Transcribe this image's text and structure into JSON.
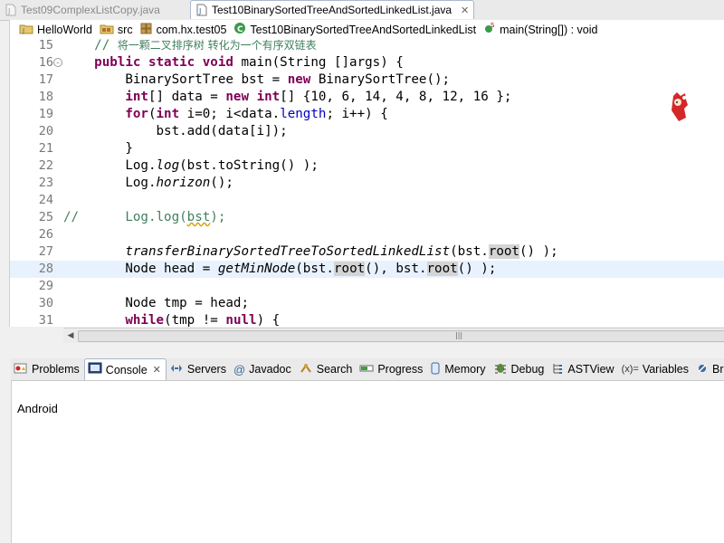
{
  "editor_tabs": [
    {
      "label": "Test09ComplexListCopy.java",
      "active": false
    },
    {
      "label": "Test10BinarySortedTreeAndSortedLinkedList.java",
      "active": true,
      "close": "✕"
    }
  ],
  "breadcrumb": [
    {
      "label": "HelloWorld",
      "icon": "project-icon"
    },
    {
      "label": "src",
      "icon": "source-folder-icon"
    },
    {
      "label": "com.hx.test05",
      "icon": "package-icon"
    },
    {
      "label": "Test10BinarySortedTreeAndSortedLinkedList",
      "icon": "class-icon"
    },
    {
      "label": "main(String[]) : void",
      "icon": "method-icon"
    }
  ],
  "code": {
    "current_line": "28",
    "lines": [
      {
        "n": "15"
      },
      {
        "n": "16"
      },
      {
        "n": "17"
      },
      {
        "n": "18"
      },
      {
        "n": "19"
      },
      {
        "n": "20"
      },
      {
        "n": "21"
      },
      {
        "n": "22"
      },
      {
        "n": "23"
      },
      {
        "n": "24"
      },
      {
        "n": "25"
      },
      {
        "n": "26"
      },
      {
        "n": "27"
      },
      {
        "n": "28"
      },
      {
        "n": "29"
      },
      {
        "n": "30"
      },
      {
        "n": "31"
      }
    ],
    "t": {
      "l15_comment_slash": "// ",
      "l15_comment_text": "将一颗二叉排序树 转化为一个有序双链表",
      "l16_public": "public",
      "l16_static": "static",
      "l16_void": "void",
      "l16_rest": " main(String []args) {",
      "l17_a": "        BinarySortTree bst = ",
      "l17_new": "new",
      "l17_b": " BinarySortTree();",
      "l18_int": "int",
      "l18_a": "[] data = ",
      "l18_new": "new",
      "l18_int2": "int",
      "l18_b": "[] {10, 6, 14, 4, 8, 12, 16 };",
      "l19_for": "for",
      "l19_a": "(",
      "l19_int": "int",
      "l19_b": " i=0; i<data.",
      "l19_length": "length",
      "l19_c": "; i++) {",
      "l20": "            bst.add(data[i]);",
      "l21": "        }",
      "l22_a": "        Log.",
      "l22_log": "log",
      "l22_b": "(bst.toString() );",
      "l23_a": "        Log.",
      "l23_horizon": "horizon",
      "l23_b": "();",
      "l25_a": "//      Log.log(",
      "l25_bst": "bst",
      "l25_b": ");",
      "l27_method": "transferBinarySortedTreeToSortedLinkedList",
      "l27_a": "(bst.",
      "l27_root": "root",
      "l27_b": "() );",
      "l28_a": "        Node head = ",
      "l28_method": "getMinNode",
      "l28_b": "(bst.",
      "l28_root1": "root",
      "l28_c": "(), bst.",
      "l28_root2": "root",
      "l28_d": "() );",
      "l30": "        Node tmp = head;",
      "l31_while": "while",
      "l31_a": "(tmp != ",
      "l31_null": "null",
      "l31_b": ") {"
    }
  },
  "view_tabs": [
    {
      "label": "Problems",
      "icon": "problems-icon"
    },
    {
      "label": "Console",
      "icon": "console-icon",
      "active": true,
      "close": "✕"
    },
    {
      "label": "Servers",
      "icon": "servers-icon"
    },
    {
      "label": "Javadoc",
      "icon": "javadoc-icon"
    },
    {
      "label": "Search",
      "icon": "search-icon"
    },
    {
      "label": "Progress",
      "icon": "progress-icon"
    },
    {
      "label": "Memory",
      "icon": "memory-icon"
    },
    {
      "label": "Debug",
      "icon": "debug-icon"
    },
    {
      "label": "ASTView",
      "icon": "astview-icon"
    },
    {
      "label": "Variables",
      "icon": "variables-icon",
      "icon_text": "(x)="
    },
    {
      "label": "Brea",
      "icon": "breakpoints-icon"
    }
  ],
  "console": {
    "output": "Android"
  },
  "scrollbar": {
    "grip": "|||"
  },
  "colors": {
    "keyword": "#7f0055",
    "comment": "#3f7f5f",
    "field": "#0000c0",
    "current_line": "#e8f2fe"
  }
}
